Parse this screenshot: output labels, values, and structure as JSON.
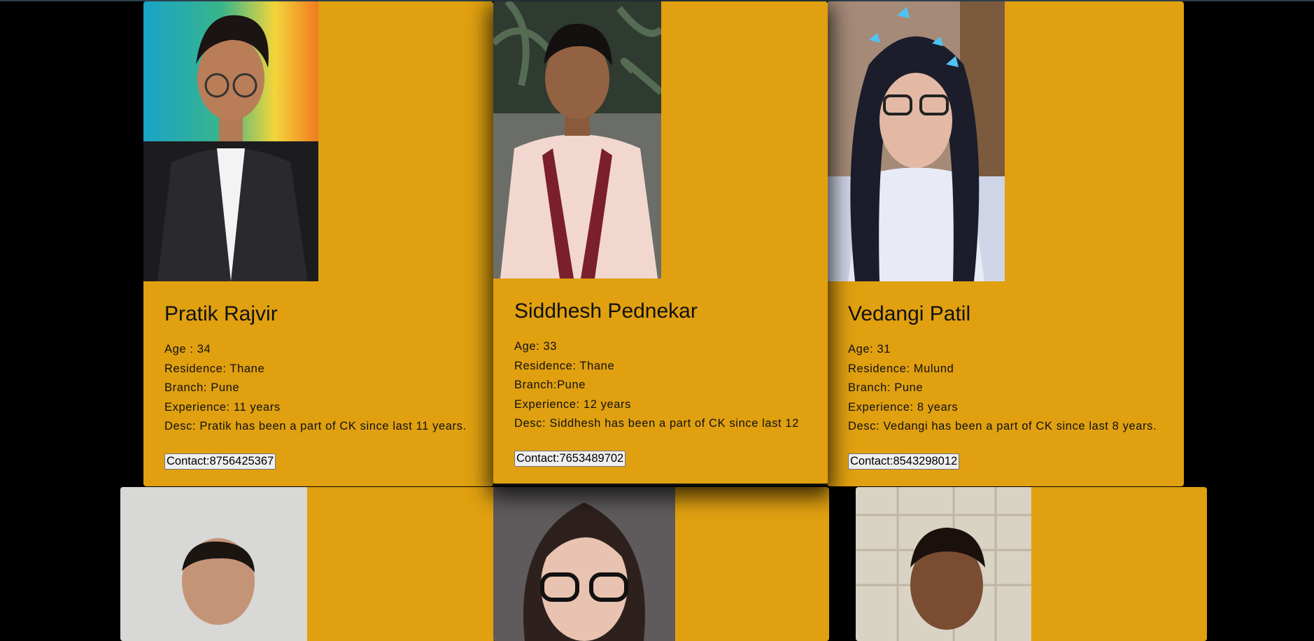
{
  "members": [
    {
      "name": "Pratik Rajvir",
      "age": "Age : 34",
      "residence": "Residence: Thane",
      "branch": "Branch: Pune",
      "experience": "Experience: 11 years",
      "desc": "Desc: Pratik has been a part of CK since last 11 years.",
      "contact": "Contact:8756425367"
    },
    {
      "name": "Siddhesh Pednekar",
      "age": "Age: 33",
      "residence": "Residence: Thane",
      "branch": "Branch:Pune",
      "experience": "Experience: 12 years",
      "desc": "Desc: Siddhesh has been a part of CK since last 12",
      "contact": "Contact:7653489702"
    },
    {
      "name": "Vedangi Patil",
      "age": "Age: 31",
      "residence": "Residence: Mulund",
      "branch": "Branch: Pune",
      "experience": "Experience: 8 years",
      "desc": "Desc: Vedangi has been a part of CK since last 8 years.",
      "contact": "Contact:8543298012"
    }
  ],
  "colors": {
    "background": "#000000",
    "card": "#e0a010",
    "text": "#111111"
  }
}
